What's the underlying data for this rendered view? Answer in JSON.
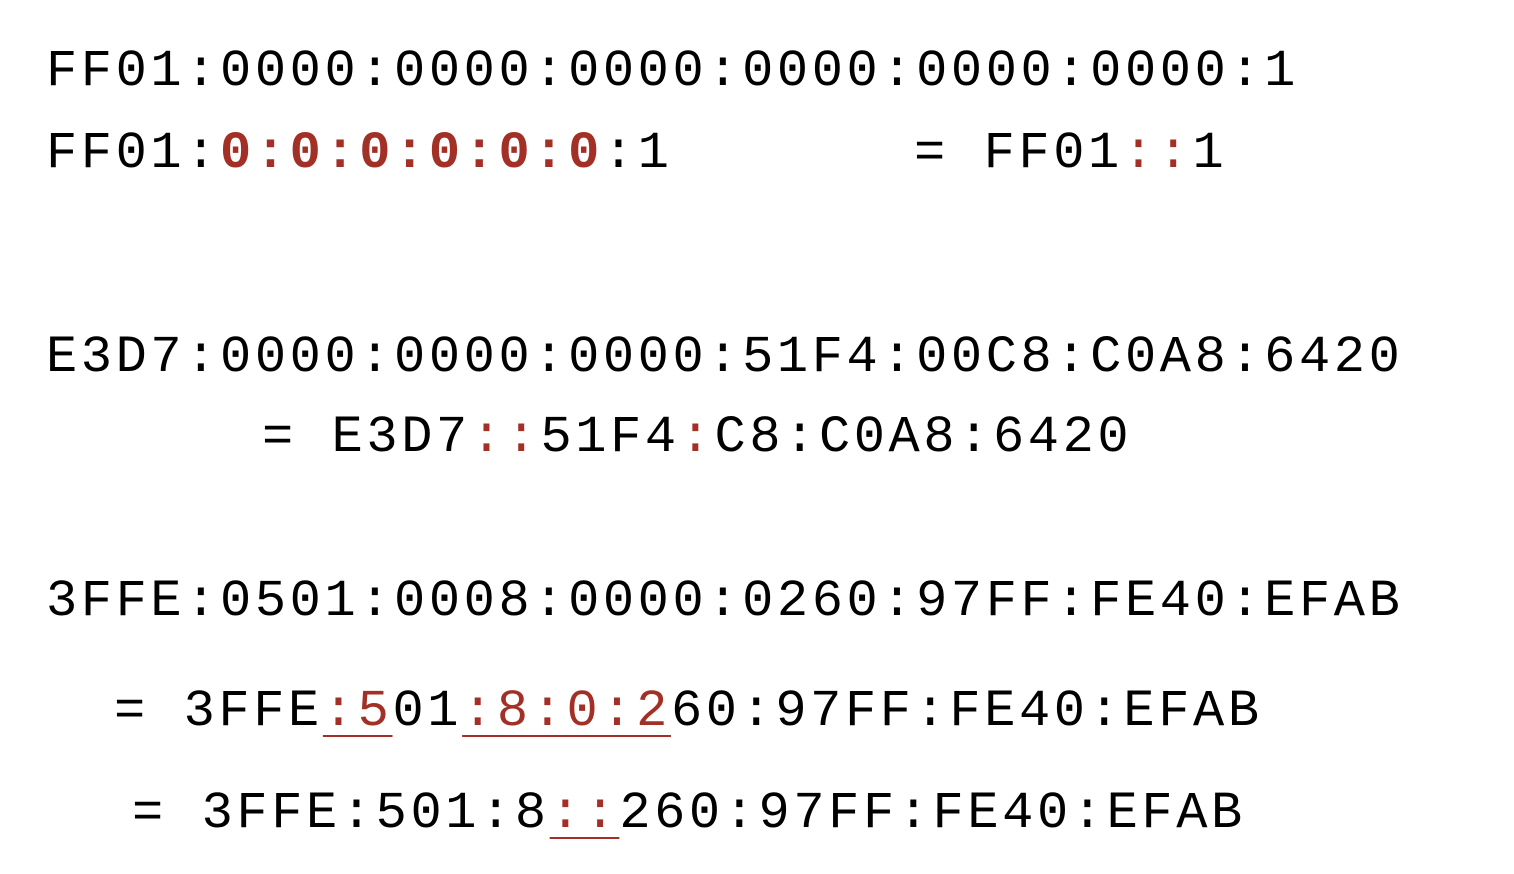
{
  "example1": {
    "full": "FF01:0000:0000:0000:0000:0000:0000:1",
    "prefix": "FF01:",
    "zeros": "0:0:0:0:0:0",
    "suffix": ":1",
    "equals": "=",
    "short_a": "FF01",
    "short_colons": "::",
    "short_b": "1"
  },
  "example2": {
    "full": "E3D7:0000:0000:0000:51F4:00C8:C0A8:6420",
    "equals": "=",
    "a": "E3D7",
    "double_colon": "::",
    "b": "51F4",
    "colon": ":",
    "c": "C8:C0A8:6420"
  },
  "example3": {
    "full": "3FFE:0501:0008:0000:0260:97FF:FE40:EFAB",
    "step1": {
      "equals": "=",
      "a": "3FFE",
      "hl1": ":5",
      "b": "01",
      "hl2": ":8:0:2",
      "c": "60:97FF:FE40:EFAB"
    },
    "step2": {
      "equals": "=",
      "a": "3FFE:501:8",
      "hl": "::",
      "b": "260:97FF:FE40:EFAB"
    }
  },
  "colors": {
    "text": "#000000",
    "highlight": "#a33026"
  }
}
